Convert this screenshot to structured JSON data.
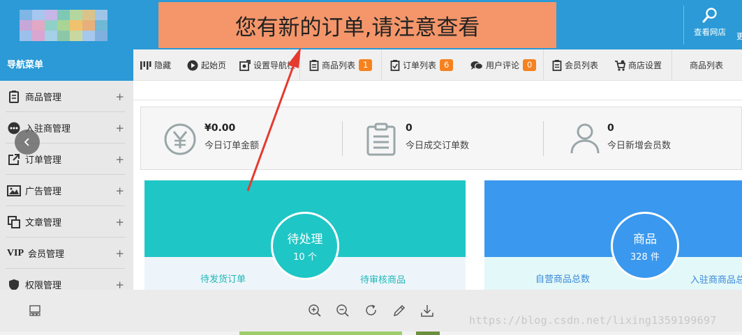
{
  "header": {
    "alert_text": "您有新的订单,请注意查看",
    "view_store_label": "查看网店",
    "more_label": "更"
  },
  "sidebar": {
    "title": "导航菜单",
    "items": [
      {
        "label": "商品管理",
        "icon": "goods-icon"
      },
      {
        "label": "入驻商管理",
        "icon": "merchant-icon"
      },
      {
        "label": "订单管理",
        "icon": "order-icon"
      },
      {
        "label": "广告管理",
        "icon": "ad-icon"
      },
      {
        "label": "文章管理",
        "icon": "article-icon"
      },
      {
        "label": "会员管理",
        "icon": "vip-icon"
      },
      {
        "label": "权限管理",
        "icon": "shield-icon"
      }
    ],
    "expand_symbol": "+"
  },
  "toolbar": {
    "items": [
      {
        "label": "隐藏",
        "icon": "hide-icon"
      },
      {
        "label": "起始页",
        "icon": "play-icon"
      },
      {
        "label": "设置导航栏",
        "icon": "settings-nav-icon"
      },
      {
        "label": "商品列表",
        "icon": "goods-list-icon",
        "badge": "1"
      },
      {
        "label": "订单列表",
        "icon": "order-list-icon",
        "badge": "6"
      },
      {
        "label": "用户评论",
        "icon": "comment-icon",
        "badge": "0"
      },
      {
        "label": "会员列表",
        "icon": "member-list-icon"
      },
      {
        "label": "商店设置",
        "icon": "store-settings-icon"
      },
      {
        "label": "商品列表"
      }
    ]
  },
  "stats": [
    {
      "value": "¥0.00",
      "label": "今日订单金额",
      "icon": "yen-icon"
    },
    {
      "value": "0",
      "label": "今日成交订单数",
      "icon": "clipboard-icon"
    },
    {
      "value": "0",
      "label": "今日新增会员数",
      "icon": "user-icon"
    }
  ],
  "cards": [
    {
      "title": "待处理",
      "count": "10 个",
      "left_label": "待发货订单",
      "right_label": "待审核商品",
      "color": "#1fc6c6",
      "bottom_color": "#edf5fb"
    },
    {
      "title": "商品",
      "count": "328 件",
      "left_label": "自营商品总数",
      "right_label": "入驻商商品总数",
      "color": "#3a98ee",
      "bottom_color": "#e3f8f8"
    }
  ],
  "viewer": {
    "icons": [
      "thumbnail-icon",
      "zoom-in-icon",
      "zoom-out-icon",
      "rotate-icon",
      "edit-icon",
      "download-icon"
    ]
  },
  "watermark": "https://blog.csdn.net/lixing1359199697",
  "colors": {
    "header_blue": "#2b9ad6",
    "alert_bg": "#f4966a",
    "badge_orange": "#f5821f",
    "arrow_red": "#e53a2f"
  }
}
